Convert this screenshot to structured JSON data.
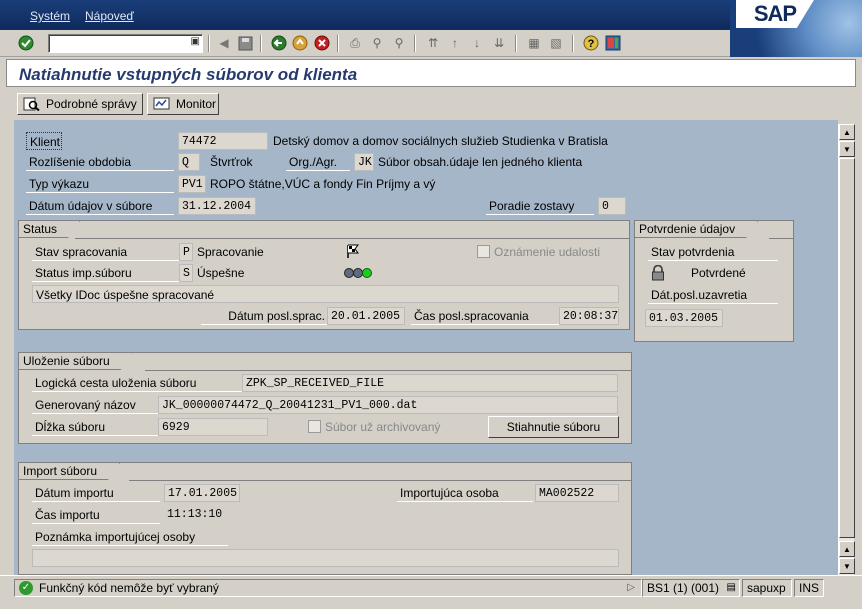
{
  "menu": {
    "system": "Systém",
    "help": "Nápoveď"
  },
  "sap_logo": "SAP",
  "toolbar": {
    "drop_glyph": "▣"
  },
  "title": "Natiahnutie vstupných súborov od klienta",
  "app_toolbar": {
    "detail_messages": "Podrobné správy",
    "monitor": "Monitor"
  },
  "header": {
    "client_label": "Klient",
    "client_value": "74472",
    "client_name": "Detský domov a domov sociálnych služieb Studienka v Bratisla",
    "period_label": "Rozlíšenie obdobia",
    "period_value": "Q",
    "period_text": "Štvrťrok",
    "org_label": "Org./Agr.",
    "org_value": "JK",
    "org_text": "Súbor obsah.údaje len jedného klienta",
    "report_type_label": "Typ výkazu",
    "report_type_value": "PV1",
    "report_type_text": "ROPO štátne,VÚC a fondy Fin Príjmy a vý",
    "date_label": "Dátum údajov v súbore",
    "date_value": "31.12.2004",
    "order_label": "Poradie zostavy",
    "order_value": "0"
  },
  "status_group": {
    "title": "Status",
    "processing_label": "Stav spracovania",
    "processing_value": "P",
    "processing_text": "Spracovanie",
    "event_notice": "Oznámenie udalosti",
    "import_status_label": "Status imp.súboru",
    "import_status_value": "S",
    "import_status_text": "Úspešne",
    "message": "Všetky IDoc úspešne spracované",
    "last_proc_date_label": "Dátum posl.sprac.",
    "last_proc_date_value": "20.01.2005",
    "last_proc_time_label": "Čas posl.spracovania",
    "last_proc_time_value": "20:08:37"
  },
  "confirm_group": {
    "title": "Potvrdenie údajov",
    "confirm_status_label": "Stav potvrdenia",
    "confirm_status_text": "Potvrdené",
    "last_close_date_label": "Dát.posl.uzavretia",
    "last_close_date_value": "01.03.2005"
  },
  "storage_group": {
    "title": "Uloženie súboru",
    "logical_path_label": "Logická cesta uloženia súboru",
    "logical_path_value": "ZPK_SP_RECEIVED_FILE",
    "generated_name_label": "Generovaný názov",
    "generated_name_value": "JK_00000074472_Q_20041231_PV1_000.dat",
    "file_length_label": "Dĺžka súboru",
    "file_length_value": "6929",
    "archived_label": "Súbor už archivovaný",
    "download_button": "Stiahnutie súboru"
  },
  "import_group": {
    "title": "Import súboru",
    "import_date_label": "Dátum importu",
    "import_date_value": "17.01.2005",
    "importer_label": "Importujúca osoba",
    "importer_value": "MA002522",
    "import_time_label": "Čas importu",
    "import_time_value": "11:13:10",
    "note_label": "Poznámka importujúcej osoby",
    "note_value": ""
  },
  "statusbar": {
    "message": "Funkčný kód nemôže byť vybraný",
    "session": "BS1 (1) (001)",
    "server": "sapuxp",
    "mode": "INS"
  }
}
